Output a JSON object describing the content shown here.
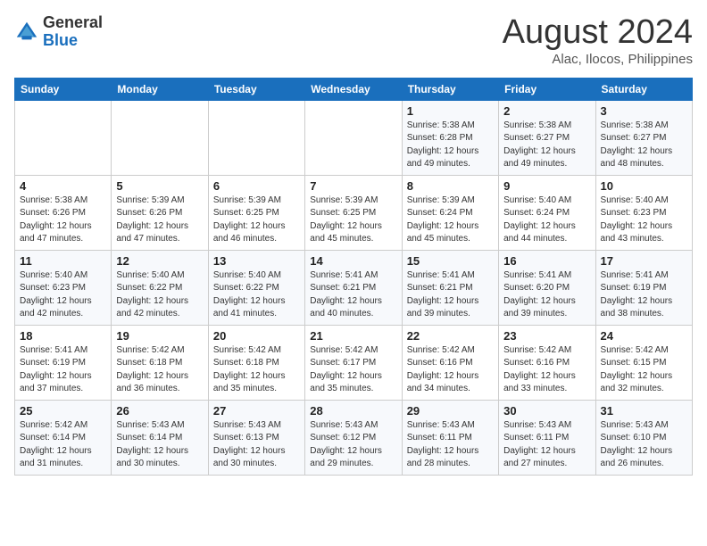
{
  "header": {
    "logo_line1": "General",
    "logo_line2": "Blue",
    "month": "August 2024",
    "location": "Alac, Ilocos, Philippines"
  },
  "weekdays": [
    "Sunday",
    "Monday",
    "Tuesday",
    "Wednesday",
    "Thursday",
    "Friday",
    "Saturday"
  ],
  "weeks": [
    [
      {
        "day": "",
        "info": ""
      },
      {
        "day": "",
        "info": ""
      },
      {
        "day": "",
        "info": ""
      },
      {
        "day": "",
        "info": ""
      },
      {
        "day": "1",
        "info": "Sunrise: 5:38 AM\nSunset: 6:28 PM\nDaylight: 12 hours\nand 49 minutes."
      },
      {
        "day": "2",
        "info": "Sunrise: 5:38 AM\nSunset: 6:27 PM\nDaylight: 12 hours\nand 49 minutes."
      },
      {
        "day": "3",
        "info": "Sunrise: 5:38 AM\nSunset: 6:27 PM\nDaylight: 12 hours\nand 48 minutes."
      }
    ],
    [
      {
        "day": "4",
        "info": "Sunrise: 5:38 AM\nSunset: 6:26 PM\nDaylight: 12 hours\nand 47 minutes."
      },
      {
        "day": "5",
        "info": "Sunrise: 5:39 AM\nSunset: 6:26 PM\nDaylight: 12 hours\nand 47 minutes."
      },
      {
        "day": "6",
        "info": "Sunrise: 5:39 AM\nSunset: 6:25 PM\nDaylight: 12 hours\nand 46 minutes."
      },
      {
        "day": "7",
        "info": "Sunrise: 5:39 AM\nSunset: 6:25 PM\nDaylight: 12 hours\nand 45 minutes."
      },
      {
        "day": "8",
        "info": "Sunrise: 5:39 AM\nSunset: 6:24 PM\nDaylight: 12 hours\nand 45 minutes."
      },
      {
        "day": "9",
        "info": "Sunrise: 5:40 AM\nSunset: 6:24 PM\nDaylight: 12 hours\nand 44 minutes."
      },
      {
        "day": "10",
        "info": "Sunrise: 5:40 AM\nSunset: 6:23 PM\nDaylight: 12 hours\nand 43 minutes."
      }
    ],
    [
      {
        "day": "11",
        "info": "Sunrise: 5:40 AM\nSunset: 6:23 PM\nDaylight: 12 hours\nand 42 minutes."
      },
      {
        "day": "12",
        "info": "Sunrise: 5:40 AM\nSunset: 6:22 PM\nDaylight: 12 hours\nand 42 minutes."
      },
      {
        "day": "13",
        "info": "Sunrise: 5:40 AM\nSunset: 6:22 PM\nDaylight: 12 hours\nand 41 minutes."
      },
      {
        "day": "14",
        "info": "Sunrise: 5:41 AM\nSunset: 6:21 PM\nDaylight: 12 hours\nand 40 minutes."
      },
      {
        "day": "15",
        "info": "Sunrise: 5:41 AM\nSunset: 6:21 PM\nDaylight: 12 hours\nand 39 minutes."
      },
      {
        "day": "16",
        "info": "Sunrise: 5:41 AM\nSunset: 6:20 PM\nDaylight: 12 hours\nand 39 minutes."
      },
      {
        "day": "17",
        "info": "Sunrise: 5:41 AM\nSunset: 6:19 PM\nDaylight: 12 hours\nand 38 minutes."
      }
    ],
    [
      {
        "day": "18",
        "info": "Sunrise: 5:41 AM\nSunset: 6:19 PM\nDaylight: 12 hours\nand 37 minutes."
      },
      {
        "day": "19",
        "info": "Sunrise: 5:42 AM\nSunset: 6:18 PM\nDaylight: 12 hours\nand 36 minutes."
      },
      {
        "day": "20",
        "info": "Sunrise: 5:42 AM\nSunset: 6:18 PM\nDaylight: 12 hours\nand 35 minutes."
      },
      {
        "day": "21",
        "info": "Sunrise: 5:42 AM\nSunset: 6:17 PM\nDaylight: 12 hours\nand 35 minutes."
      },
      {
        "day": "22",
        "info": "Sunrise: 5:42 AM\nSunset: 6:16 PM\nDaylight: 12 hours\nand 34 minutes."
      },
      {
        "day": "23",
        "info": "Sunrise: 5:42 AM\nSunset: 6:16 PM\nDaylight: 12 hours\nand 33 minutes."
      },
      {
        "day": "24",
        "info": "Sunrise: 5:42 AM\nSunset: 6:15 PM\nDaylight: 12 hours\nand 32 minutes."
      }
    ],
    [
      {
        "day": "25",
        "info": "Sunrise: 5:42 AM\nSunset: 6:14 PM\nDaylight: 12 hours\nand 31 minutes."
      },
      {
        "day": "26",
        "info": "Sunrise: 5:43 AM\nSunset: 6:14 PM\nDaylight: 12 hours\nand 30 minutes."
      },
      {
        "day": "27",
        "info": "Sunrise: 5:43 AM\nSunset: 6:13 PM\nDaylight: 12 hours\nand 30 minutes."
      },
      {
        "day": "28",
        "info": "Sunrise: 5:43 AM\nSunset: 6:12 PM\nDaylight: 12 hours\nand 29 minutes."
      },
      {
        "day": "29",
        "info": "Sunrise: 5:43 AM\nSunset: 6:11 PM\nDaylight: 12 hours\nand 28 minutes."
      },
      {
        "day": "30",
        "info": "Sunrise: 5:43 AM\nSunset: 6:11 PM\nDaylight: 12 hours\nand 27 minutes."
      },
      {
        "day": "31",
        "info": "Sunrise: 5:43 AM\nSunset: 6:10 PM\nDaylight: 12 hours\nand 26 minutes."
      }
    ]
  ]
}
